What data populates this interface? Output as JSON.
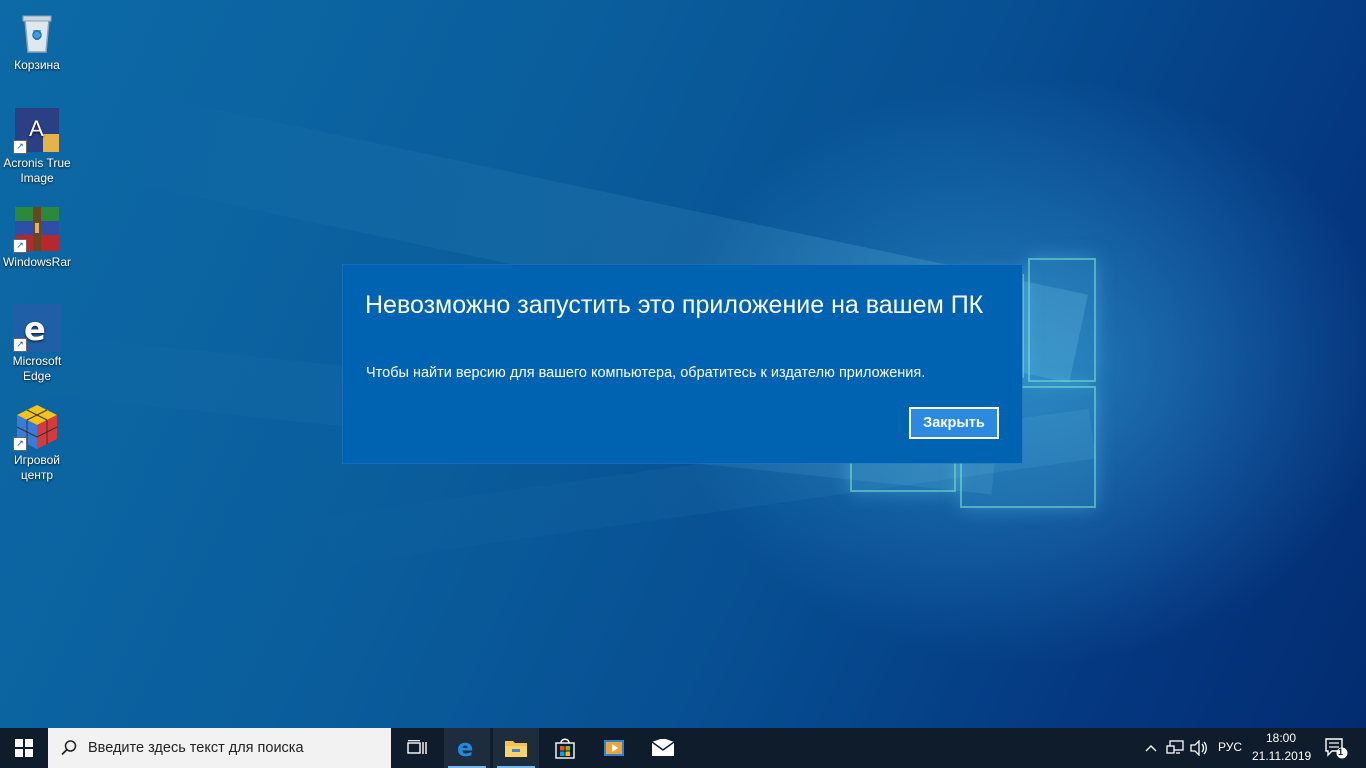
{
  "desktop": {
    "icons": [
      {
        "label_line1": "Корзина",
        "label_line2": "",
        "icon": "recycle-bin-icon"
      },
      {
        "label_line1": "Acronis True",
        "label_line2": "Image",
        "icon": "acronis-icon"
      },
      {
        "label_line1": "WindowsRar",
        "label_line2": "",
        "icon": "winrar-icon"
      },
      {
        "label_line1": "Microsoft",
        "label_line2": "Edge",
        "icon": "edge-icon"
      },
      {
        "label_line1": "Игровой",
        "label_line2": "центр",
        "icon": "game-center-icon"
      }
    ]
  },
  "dialog": {
    "title": "Невозможно запустить это приложение на вашем ПК",
    "message": "Чтобы найти версию для вашего компьютера, обратитесь к издателю приложения.",
    "close_label": "Закрыть",
    "background_color": "#0063b1",
    "button_color": "#2b8ae0"
  },
  "taskbar": {
    "search_placeholder": "Введите здесь текст для поиска",
    "pinned": [
      "task-view-icon",
      "edge-icon",
      "file-explorer-icon",
      "store-icon",
      "media-player-icon",
      "mail-icon"
    ],
    "tray": {
      "language": "РУС",
      "time": "18:00",
      "date": "21.11.2019",
      "notification_count": "1"
    }
  }
}
